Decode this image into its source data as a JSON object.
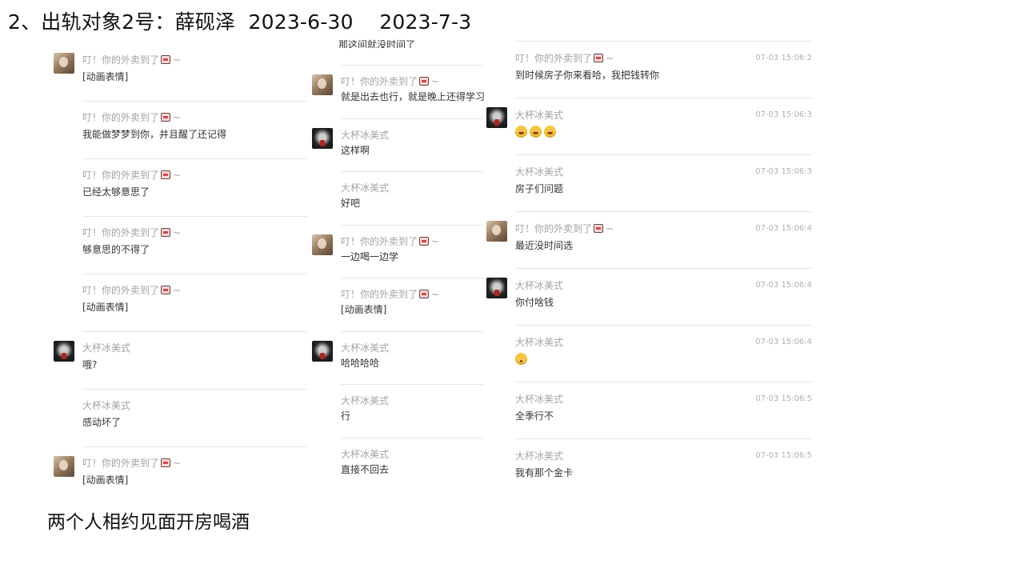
{
  "heading": "2、出轨对象2号：薛砚泽  2023-6-30    2023-7-3",
  "caption": "两个人相约见面开房喝酒",
  "partial_text": "那这间就没时间了",
  "col1": [
    {
      "nick": "叮！你的外卖到了",
      "tilde": "~",
      "content": "[动画表情]",
      "avatar": "a"
    },
    {
      "nick": "叮！你的外卖到了",
      "tilde": "~",
      "content": "我能做梦梦到你，并且醒了还记得",
      "avatar": ""
    },
    {
      "nick": "叮！你的外卖到了",
      "tilde": "~",
      "content": "已经太够意思了",
      "avatar": ""
    },
    {
      "nick": "叮！你的外卖到了",
      "tilde": "~",
      "content": "够意思的不得了",
      "avatar": ""
    },
    {
      "nick": "叮！你的外卖到了",
      "tilde": "~",
      "content": "[动画表情]",
      "avatar": ""
    },
    {
      "nick": "大杯冰美式",
      "tilde": "",
      "content": "哦?",
      "avatar": "b"
    },
    {
      "nick": "大杯冰美式",
      "tilde": "",
      "content": "感动坏了",
      "avatar": ""
    },
    {
      "nick": "叮！你的外卖到了",
      "tilde": "~",
      "content": "[动画表情]",
      "avatar": "a"
    }
  ],
  "col2": [
    {
      "nick": "叮！你的外卖到了",
      "tilde": "~",
      "content": "就是出去也行，就是晚上还得学习",
      "avatar": "a"
    },
    {
      "nick": "大杯冰美式",
      "tilde": "",
      "content": "这样啊",
      "avatar": "b"
    },
    {
      "nick": "大杯冰美式",
      "tilde": "",
      "content": "好吧",
      "avatar": ""
    },
    {
      "nick": "叮！你的外卖到了",
      "tilde": "~",
      "content": "一边喝一边学",
      "avatar": "a"
    },
    {
      "nick": "叮！你的外卖到了",
      "tilde": "~",
      "content": "[动画表情]",
      "avatar": ""
    },
    {
      "nick": "大杯冰美式",
      "tilde": "",
      "content": "哈哈哈哈",
      "avatar": "b"
    },
    {
      "nick": "大杯冰美式",
      "tilde": "",
      "content": "行",
      "avatar": ""
    },
    {
      "nick": "大杯冰美式",
      "tilde": "",
      "content": "直接不回去",
      "avatar": ""
    }
  ],
  "col3": [
    {
      "nick": "叮！你的外卖到了",
      "tilde": "~",
      "content": "到时候房子你来看哈，我把钱转你",
      "time": "07-03 15:06:2",
      "avatar": ""
    },
    {
      "nick": "大杯冰美式",
      "tilde": "",
      "content": "",
      "emojis": [
        "laugh-cry-emoji",
        "laugh-cry-emoji",
        "laugh-cry-emoji"
      ],
      "time": "07-03 15:06:3",
      "avatar": "b"
    },
    {
      "nick": "大杯冰美式",
      "tilde": "",
      "content": "房子们问题",
      "time": "07-03 15:06:3",
      "avatar": ""
    },
    {
      "nick": "叮！你的外卖到了",
      "tilde": "~",
      "content": "最近没时间选",
      "time": "07-03 15:06:4",
      "avatar": "a"
    },
    {
      "nick": "大杯冰美式",
      "tilde": "",
      "content": "你付啥钱",
      "time": "07-03 15:06:4",
      "avatar": "b"
    },
    {
      "nick": "大杯冰美式",
      "tilde": "",
      "content": "",
      "emojis": [
        "kissing-emoji"
      ],
      "time": "07-03 15:06:4",
      "avatar": ""
    },
    {
      "nick": "大杯冰美式",
      "tilde": "",
      "content": "全季行不",
      "time": "07-03 15:06:5",
      "avatar": ""
    },
    {
      "nick": "大杯冰美式",
      "tilde": "",
      "content": "我有那个金卡",
      "time": "07-03 15:06:5",
      "avatar": ""
    }
  ]
}
